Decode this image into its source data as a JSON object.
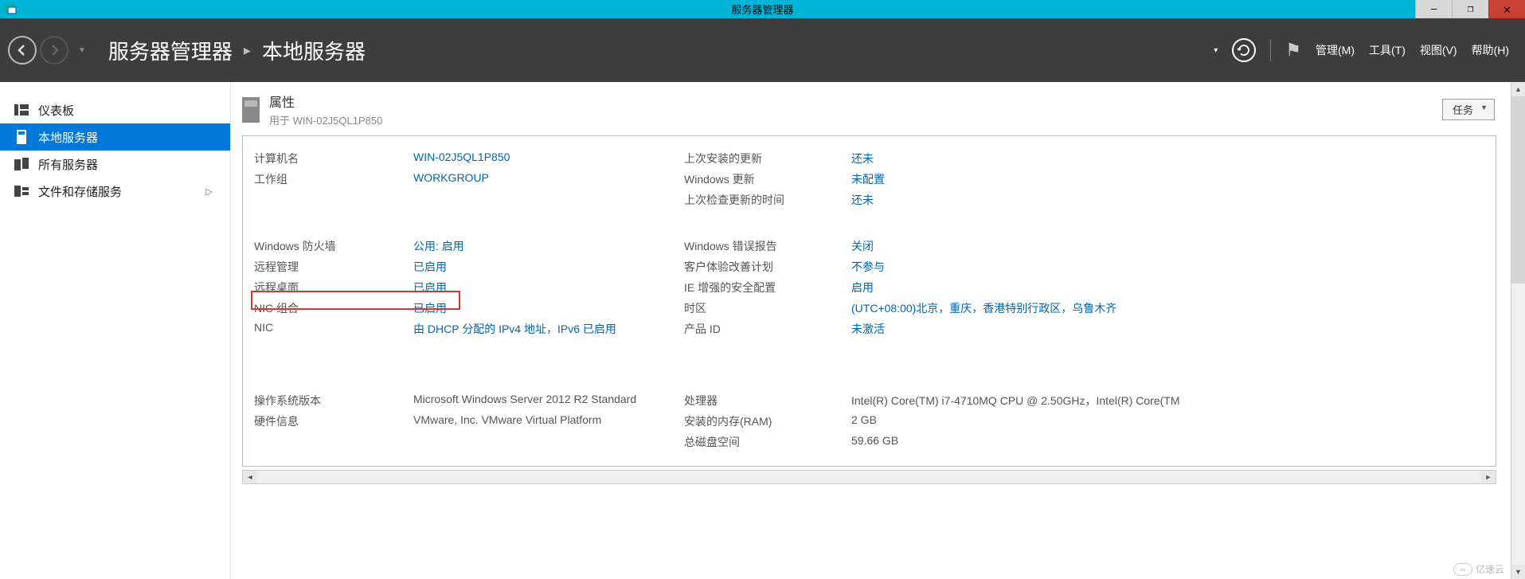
{
  "window": {
    "title": "服务器管理器"
  },
  "header": {
    "breadcrumb_root": "服务器管理器",
    "breadcrumb_page": "本地服务器",
    "menu": {
      "manage": "管理(M)",
      "tools": "工具(T)",
      "view": "视图(V)",
      "help": "帮助(H)"
    }
  },
  "sidebar": {
    "items": [
      {
        "label": "仪表板"
      },
      {
        "label": "本地服务器"
      },
      {
        "label": "所有服务器"
      },
      {
        "label": "文件和存储服务"
      }
    ]
  },
  "panel": {
    "title": "属性",
    "subtitle": "用于 WIN-02J5QL1P850",
    "tasks_label": "任务"
  },
  "props": {
    "computer_name_label": "计算机名",
    "computer_name_value": "WIN-02J5QL1P850",
    "workgroup_label": "工作组",
    "workgroup_value": "WORKGROUP",
    "last_update_label": "上次安装的更新",
    "last_update_value": "还未",
    "win_update_label": "Windows 更新",
    "win_update_value": "未配置",
    "last_check_label": "上次检查更新的时间",
    "last_check_value": "还未",
    "firewall_label": "Windows 防火墙",
    "firewall_value": "公用: 启用",
    "remote_mgmt_label": "远程管理",
    "remote_mgmt_value": "已启用",
    "remote_desktop_label": "远程桌面",
    "remote_desktop_value": "已启用",
    "nic_team_label": "NIC 组合",
    "nic_team_value": "已启用",
    "nic_label": "NIC",
    "nic_value": "由 DHCP 分配的 IPv4 地址，IPv6 已启用",
    "error_report_label": "Windows 错误报告",
    "error_report_value": "关闭",
    "ceip_label": "客户体验改善计划",
    "ceip_value": "不参与",
    "ie_esc_label": "IE 增强的安全配置",
    "ie_esc_value": "启用",
    "timezone_label": "时区",
    "timezone_value": "(UTC+08:00)北京，重庆，香港特别行政区，乌鲁木齐",
    "product_id_label": "产品 ID",
    "product_id_value": "未激活",
    "os_version_label": "操作系统版本",
    "os_version_value": "Microsoft Windows Server 2012 R2 Standard",
    "hw_info_label": "硬件信息",
    "hw_info_value": "VMware, Inc. VMware Virtual Platform",
    "cpu_label": "处理器",
    "cpu_value": "Intel(R) Core(TM) i7-4710MQ CPU @ 2.50GHz，Intel(R) Core(TM",
    "ram_label": "安装的内存(RAM)",
    "ram_value": "2 GB",
    "disk_label": "总磁盘空间",
    "disk_value": "59.66 GB"
  },
  "watermark": "亿速云"
}
